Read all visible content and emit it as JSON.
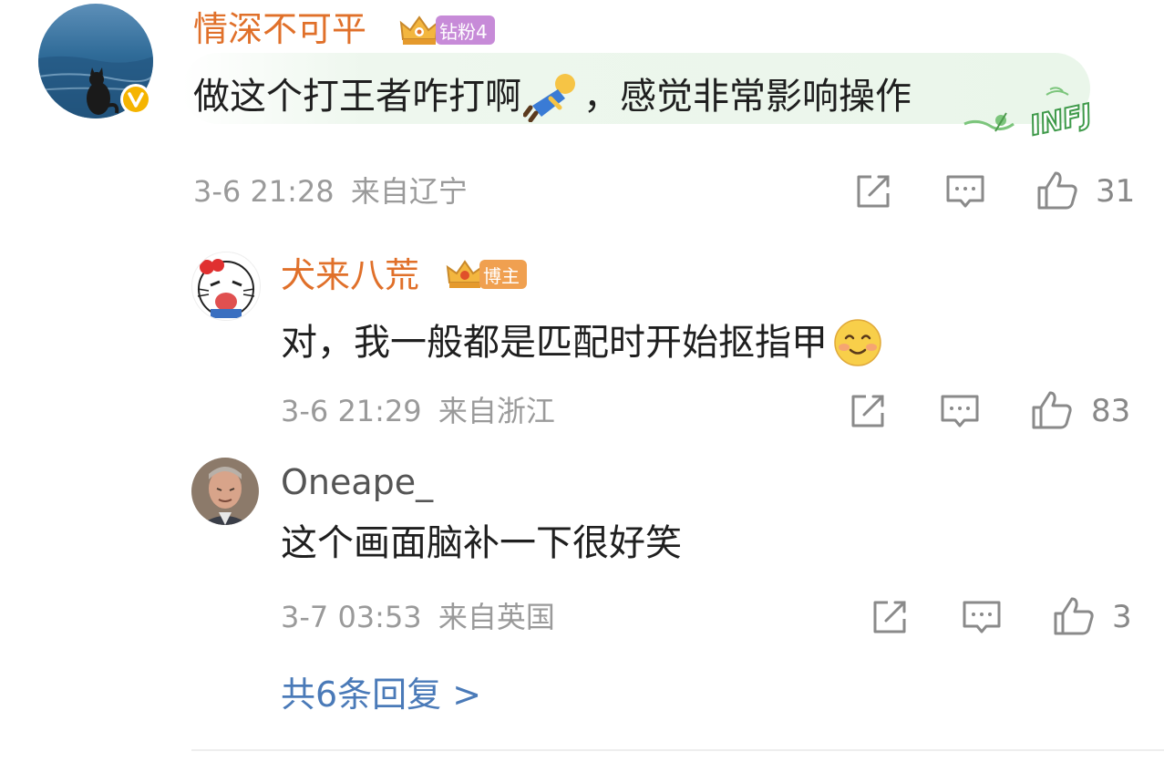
{
  "comments": [
    {
      "author": "情深不可平",
      "badge": "钻粉4",
      "text_before": "做这个打王者咋打啊",
      "text_after": "，感觉非常影响操作",
      "decoration_text": "INFJ",
      "time": "3-6 21:28",
      "location": "来自辽宁",
      "likes": "31"
    },
    {
      "author": "犬来八荒",
      "badge": "博主",
      "text": "对，我一般都是匹配时开始抠指甲",
      "time": "3-6 21:29",
      "location": "来自浙江",
      "likes": "83"
    },
    {
      "author": "Oneape_",
      "text": "这个画面脑补一下很好笑",
      "time": "3-7 03:53",
      "location": "来自英国",
      "likes": "3"
    }
  ],
  "replies_link": "共6条回复 >",
  "colors": {
    "author_accent": "#e0702a",
    "link": "#4a7ab8",
    "meta": "#9a9a9a"
  }
}
